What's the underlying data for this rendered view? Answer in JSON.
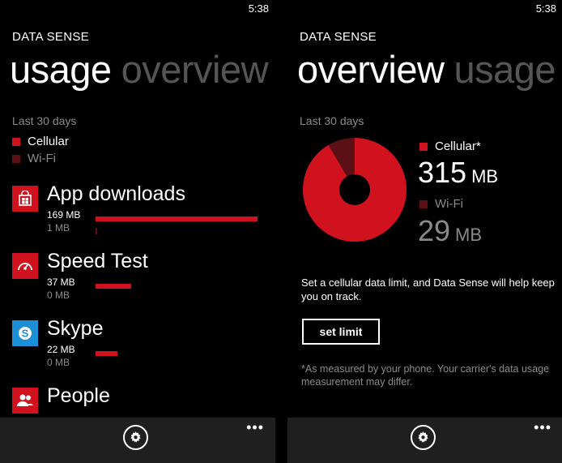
{
  "left": {
    "status_time": "5:38",
    "app_title": "DATA SENSE",
    "pivot_active": "usage",
    "pivot_inactive": "overview",
    "period": "Last 30 days",
    "legend": {
      "cellular": "Cellular",
      "wifi": "Wi-Fi"
    },
    "apps": [
      {
        "name": "App downloads",
        "cellular": "169 MB",
        "wifi": "1 MB",
        "cellular_fraction": 1.0,
        "icon": "store-icon",
        "color": "#d0121f"
      },
      {
        "name": "Speed Test",
        "cellular": "37 MB",
        "wifi": "0 MB",
        "cellular_fraction": 0.22,
        "icon": "speedometer-icon",
        "color": "#d0121f"
      },
      {
        "name": "Skype",
        "cellular": "22 MB",
        "wifi": "0 MB",
        "cellular_fraction": 0.13,
        "icon": "skype-icon",
        "color": "#1c8fd6"
      },
      {
        "name": "People",
        "cellular": "",
        "wifi": "",
        "cellular_fraction": 0,
        "icon": "people-icon",
        "color": "#d0121f"
      }
    ],
    "appbar": {
      "more": "•••"
    }
  },
  "right": {
    "status_time": "5:38",
    "app_title": "DATA SENSE",
    "pivot_active": "overview",
    "pivot_inactive": "usage",
    "period": "Last 30 days",
    "cellular_label": "Cellular*",
    "cellular_value": "315",
    "cellular_unit": "MB",
    "wifi_label": "Wi-Fi",
    "wifi_value": "29",
    "wifi_unit": "MB",
    "donut": {
      "cellular_mb": 315,
      "wifi_mb": 29
    },
    "message": "Set a cellular data limit, and Data Sense will help keep you on track.",
    "set_limit_label": "set limit",
    "footnote": "*As measured by your phone. Your carrier's data usage measurement may differ.",
    "appbar": {
      "more": "•••"
    }
  },
  "colors": {
    "cellular": "#d0121f",
    "wifi": "#5a1015",
    "skype": "#1c8fd6"
  }
}
